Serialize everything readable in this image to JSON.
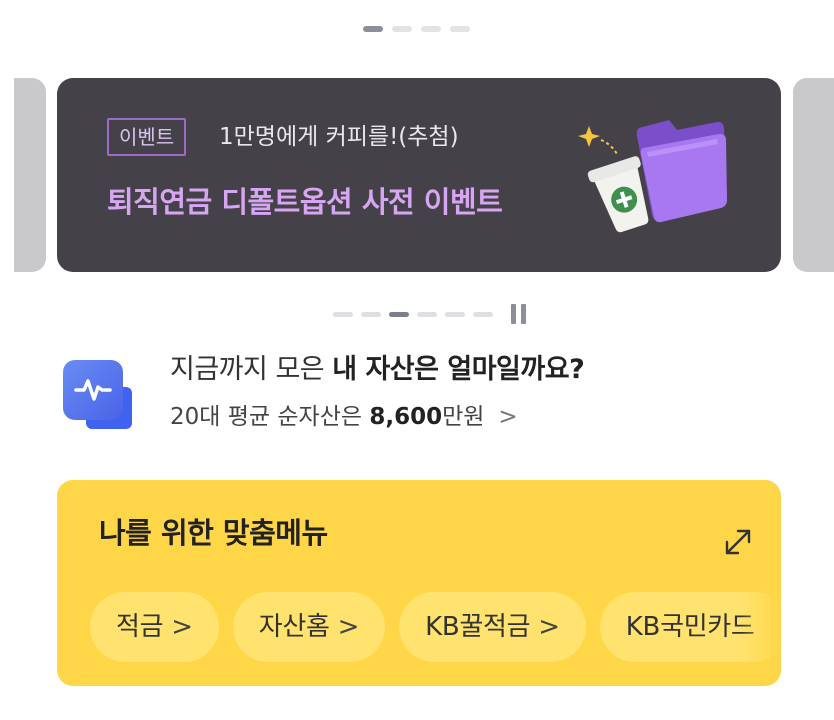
{
  "colors": {
    "banner_bg": "#444248",
    "banner_headline": "#d7a6f2",
    "tag_border": "#9d6bc8",
    "menu_bg": "#ffd648",
    "chip_bg": "#ffe36e"
  },
  "top_indicator": {
    "count": 4,
    "active_index": 0
  },
  "banner": {
    "tag": "이벤트",
    "subtitle": "1만명에게 커피를!(추첨)",
    "headline": "퇴직연금 디폴트옵션 사전 이벤트",
    "illustration": "coffee-cup-and-purple-folder",
    "pagination": {
      "count": 6,
      "active_index": 2
    },
    "pause_icon": "pause-icon"
  },
  "asset": {
    "icon": "asset-chart-icon",
    "question_prefix": "지금까지 모은 ",
    "question_bold": "내 자산은 얼마일까요?",
    "avg_prefix": "20대 평균 순자산은 ",
    "avg_value": "8,600",
    "avg_suffix": "만원",
    "chevron": ">"
  },
  "custom_menu": {
    "title": "나를 위한 맞춤메뉴",
    "expand_icon": "expand-arrows-icon",
    "chips": [
      {
        "label": "적금",
        "chevron": ">"
      },
      {
        "label": "자산홈",
        "chevron": ">"
      },
      {
        "label": "KB꿀적금",
        "chevron": ">"
      },
      {
        "label": "KB국민카드",
        "chevron": ""
      }
    ]
  }
}
